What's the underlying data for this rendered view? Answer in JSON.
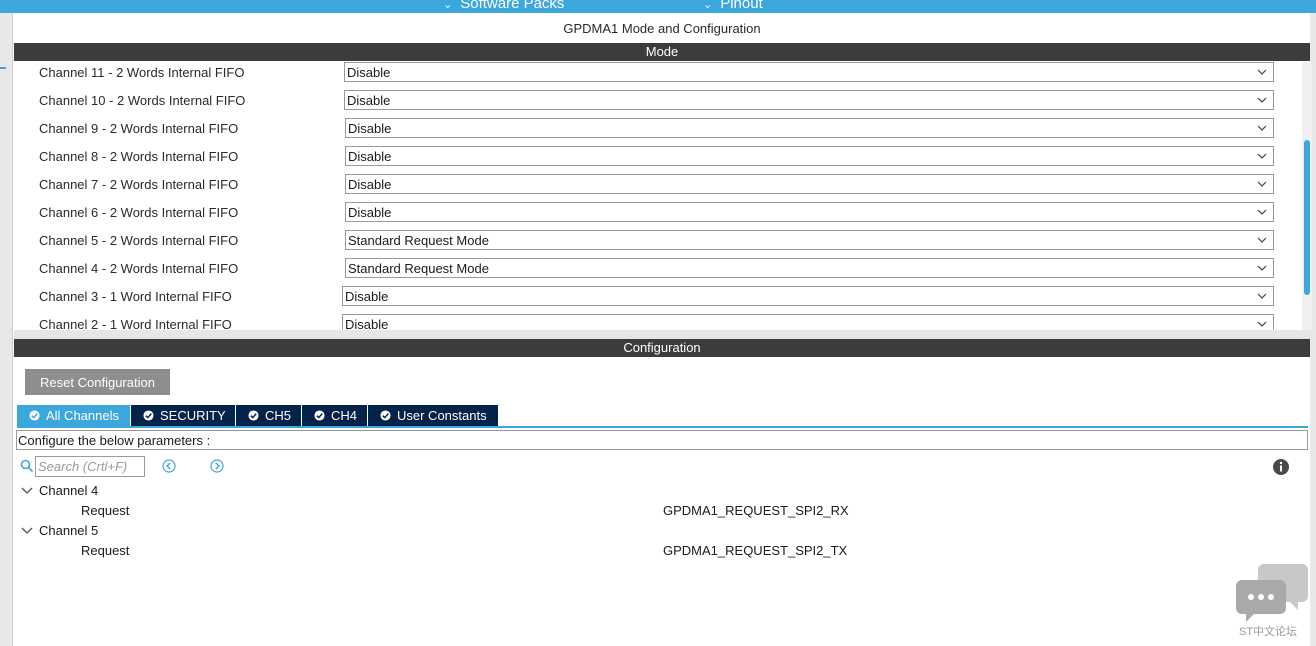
{
  "topbar": {
    "items": [
      {
        "label": "Software Packs"
      },
      {
        "label": "Pinout"
      }
    ]
  },
  "panel": {
    "title": "GPDMA1 Mode and Configuration"
  },
  "mode": {
    "header": "Mode",
    "rows": [
      {
        "label": "Channel 11  - 2 Words Internal FIFO",
        "value": "Disable"
      },
      {
        "label": "Channel 10  - 2 Words Internal FIFO",
        "value": "Disable"
      },
      {
        "label": "Channel 9  - 2 Words Internal FIFO",
        "value": "Disable"
      },
      {
        "label": "Channel 8  - 2 Words Internal FIFO",
        "value": "Disable"
      },
      {
        "label": "Channel 7  - 2 Words Internal FIFO",
        "value": "Disable"
      },
      {
        "label": "Channel 6  - 2 Words Internal FIFO",
        "value": "Disable"
      },
      {
        "label": "Channel 5  - 2 Words Internal FIFO",
        "value": "Standard Request Mode"
      },
      {
        "label": "Channel 4  - 2 Words Internal FIFO",
        "value": "Standard Request Mode"
      },
      {
        "label": "Channel 3  - 1 Word Internal FIFO",
        "value": "Disable"
      },
      {
        "label": "Channel 2  - 1 Word Internal FIFO",
        "value": "Disable"
      }
    ]
  },
  "configuration": {
    "header": "Configuration",
    "reset_label": "Reset Configuration",
    "tabs": [
      {
        "label": "All Channels",
        "active": true
      },
      {
        "label": "SECURITY",
        "active": false
      },
      {
        "label": "CH5",
        "active": false
      },
      {
        "label": "CH4",
        "active": false
      },
      {
        "label": "User Constants",
        "active": false
      }
    ],
    "configure_text": "Configure the below parameters :",
    "search_placeholder": "Search (Crtl+F)",
    "tree": [
      {
        "group": "Channel 4",
        "param": "Request",
        "value": "GPDMA1_REQUEST_SPI2_RX"
      },
      {
        "group": "Channel 5",
        "param": "Request",
        "value": "GPDMA1_REQUEST_SPI2_TX"
      }
    ]
  },
  "watermark": {
    "text": "ST中文论坛"
  },
  "colors": {
    "accent": "#3ca7dd",
    "tab_dark": "#03234b",
    "header_bar": "#3c3c3c",
    "button_gray": "#8e8e8e"
  }
}
